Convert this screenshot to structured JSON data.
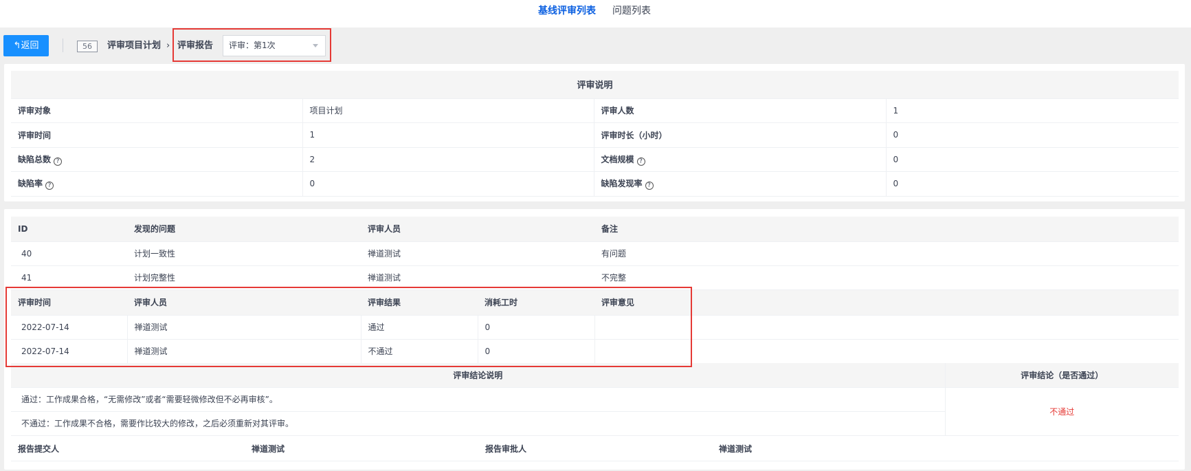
{
  "top_tabs": [
    {
      "label": "基线评审列表",
      "active": true
    },
    {
      "label": "问题列表",
      "active": false
    }
  ],
  "toolbar": {
    "back_label": "↰返回",
    "id": "56",
    "crumb_1": "评审项目计划",
    "crumb_sep": "›",
    "crumb_2": "评审报告",
    "select_value": "评审：第1次"
  },
  "review_info": {
    "title": "评审说明",
    "rows": [
      {
        "k1": "评审对象",
        "v1": "项目计划",
        "k2": "评审人数",
        "v2": "1"
      },
      {
        "k1": "评审时间",
        "v1": "1",
        "k2": "评审时长（小时）",
        "v2": "0"
      },
      {
        "k1": "缺陷总数",
        "v1": "2",
        "k2": "文档规模",
        "v2": "0"
      },
      {
        "k1": "缺陷率",
        "v1": "0",
        "k2": "缺陷发现率",
        "v2": "0"
      }
    ],
    "help_glyph": "?"
  },
  "issues": {
    "headers": [
      "ID",
      "发现的问题",
      "评审人员",
      "备注"
    ],
    "rows": [
      [
        "40",
        "计划一致性",
        "禅道测试",
        "有问题"
      ],
      [
        "41",
        "计划完整性",
        "禅道测试",
        "不完整"
      ]
    ]
  },
  "reviews": {
    "headers": [
      "评审时间",
      "评审人员",
      "评审结果",
      "消耗工时",
      "评审意见"
    ],
    "rows": [
      [
        "2022-07-14",
        "禅道测试",
        "通过",
        "0",
        ""
      ],
      [
        "2022-07-14",
        "禅道测试",
        "不通过",
        "0",
        ""
      ]
    ]
  },
  "conclusion": {
    "left_header": "评审结论说明",
    "right_header": "评审结论（是否通过）",
    "line1": "通过：工作成果合格，“无需修改”或者“需要轻微修改但不必再审核”。",
    "line2": "不通过：工作成果不合格，需要作比较大的修改，之后必须重新对其评审。",
    "result": "不通过",
    "result_color": "#e53935"
  },
  "footer": {
    "submitter_label": "报告提交人",
    "submitter": "禅道测试",
    "approver_label": "报告审批人",
    "approver": "禅道测试"
  },
  "colors": {
    "accent": "#1890ff",
    "active_tab": "#0c60e1",
    "highlight": "#e53935"
  }
}
